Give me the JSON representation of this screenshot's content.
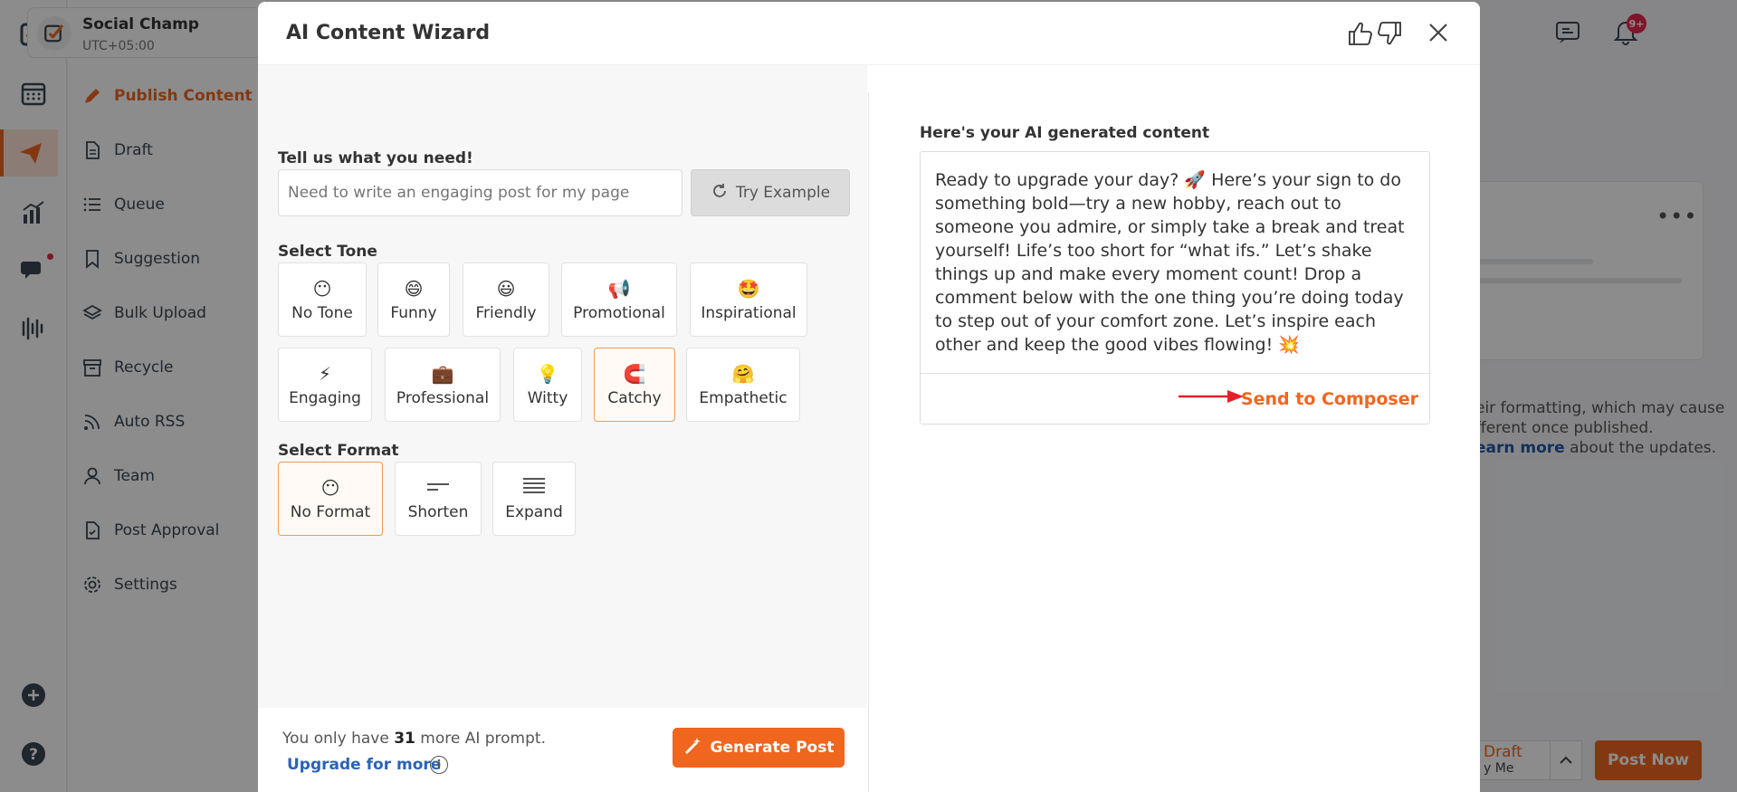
{
  "app": {
    "brand_name": "Social Champ",
    "timezone": "UTC+05:00",
    "nav": [
      {
        "label": "Publish Content",
        "icon": "pencil-icon",
        "active": true
      },
      {
        "label": "Draft",
        "icon": "document-icon"
      },
      {
        "label": "Queue",
        "icon": "list-icon"
      },
      {
        "label": "Suggestion",
        "icon": "bookmark-icon"
      },
      {
        "label": "Bulk Upload",
        "icon": "layers-icon"
      },
      {
        "label": "Recycle",
        "icon": "archive-icon"
      },
      {
        "label": "Auto RSS",
        "icon": "rss-icon"
      },
      {
        "label": "Team",
        "icon": "user-icon"
      },
      {
        "label": "Post Approval",
        "icon": "approval-icon"
      },
      {
        "label": "Settings",
        "icon": "gear-icon"
      }
    ],
    "notification_badge": "9+",
    "bg_note_line1": "eir formatting, which may cause",
    "bg_note_line2": "fferent once published.",
    "bg_note_link": "earn more",
    "bg_note_rest": " about the updates.",
    "draft_label": "Draft",
    "draft_sub": "y Me",
    "post_now": "Post Now"
  },
  "modal": {
    "title": "AI Content Wizard",
    "need_label": "Tell us what you need!",
    "need_placeholder": "Need to write an engaging post for my page",
    "try_example": "Try Example",
    "tone_label": "Select Tone",
    "tones": [
      {
        "label": "No Tone",
        "emoji": "😶",
        "selected": false
      },
      {
        "label": "Funny",
        "emoji": "😄",
        "selected": false
      },
      {
        "label": "Friendly",
        "emoji": "😃",
        "selected": false
      },
      {
        "label": "Promotional",
        "emoji": "📢",
        "selected": false
      },
      {
        "label": "Inspirational",
        "emoji": "🤩",
        "selected": false
      },
      {
        "label": "Engaging",
        "emoji": "⚡",
        "selected": false
      },
      {
        "label": "Professional",
        "emoji": "💼",
        "selected": false
      },
      {
        "label": "Witty",
        "emoji": "💡",
        "selected": false
      },
      {
        "label": "Catchy",
        "emoji": "🧲",
        "selected": true
      },
      {
        "label": "Empathetic",
        "emoji": "🤗",
        "selected": false
      }
    ],
    "format_label": "Select Format",
    "formats": [
      {
        "label": "No Format",
        "icon": "no-format-icon",
        "selected": true
      },
      {
        "label": "Shorten",
        "icon": "shorten-icon",
        "selected": false
      },
      {
        "label": "Expand",
        "icon": "expand-icon",
        "selected": false
      }
    ],
    "quota_prefix": "You only have ",
    "quota_count": "31",
    "quota_suffix": " more AI prompt.",
    "upgrade": "Upgrade for more",
    "generate": "Generate Post",
    "result_label": "Here's your AI generated content",
    "result_text": "Ready to upgrade your day? 🚀 Here’s your sign to do something bold—try a new hobby, reach out to someone you admire, or simply take a break and treat yourself! Life’s too short for “what ifs.” Let’s shake things up and make every moment count! Drop a comment below with the one thing you’re doing today to step out of your comfort zone. Let’s inspire each other and keep the good vibes flowing! 💥",
    "send_to_composer": "Send to Composer"
  },
  "colors": {
    "accent": "#f0661f",
    "link": "#2a63b8",
    "badge": "#e8274b"
  }
}
